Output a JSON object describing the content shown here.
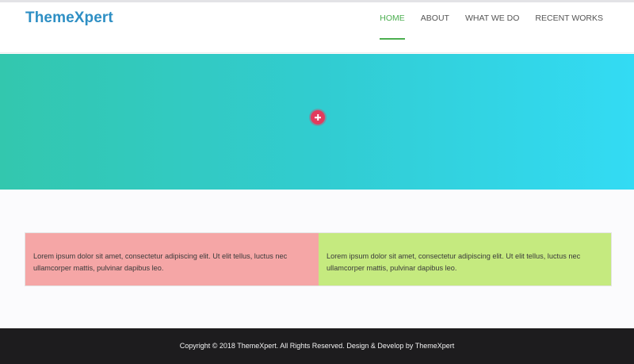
{
  "brand": {
    "name": "ThemeXpert"
  },
  "nav": {
    "items": [
      {
        "label": "HOME",
        "active": true
      },
      {
        "label": "ABOUT",
        "active": false
      },
      {
        "label": "WHAT WE DO",
        "active": false
      },
      {
        "label": "RECENT WORKS",
        "active": false
      }
    ]
  },
  "hero": {
    "gradient_start": "#33c7ae",
    "gradient_end": "#33dbf4",
    "button_icon": "plus-icon",
    "button_color": "#e23b5d"
  },
  "cards": [
    {
      "text": "Lorem ipsum dolor sit amet, consectetur adipiscing elit. Ut elit tellus, luctus nec ullamcorper mattis, pulvinar dapibus leo.",
      "color": "#f5a6a6"
    },
    {
      "text": "Lorem ipsum dolor sit amet, consectetur adipiscing elit. Ut elit tellus, luctus nec ullamcorper mattis, pulvinar dapibus leo.",
      "color": "#c5ea7f"
    }
  ],
  "footer": {
    "copyright": "Copyright © 2018 ThemeXpert. All Rights Reserved. Design & Develop by ThemeXpert"
  },
  "colors": {
    "accent": "#4caf50",
    "logo": "#2e8fc4",
    "footer_bg": "#1d1c1e"
  }
}
